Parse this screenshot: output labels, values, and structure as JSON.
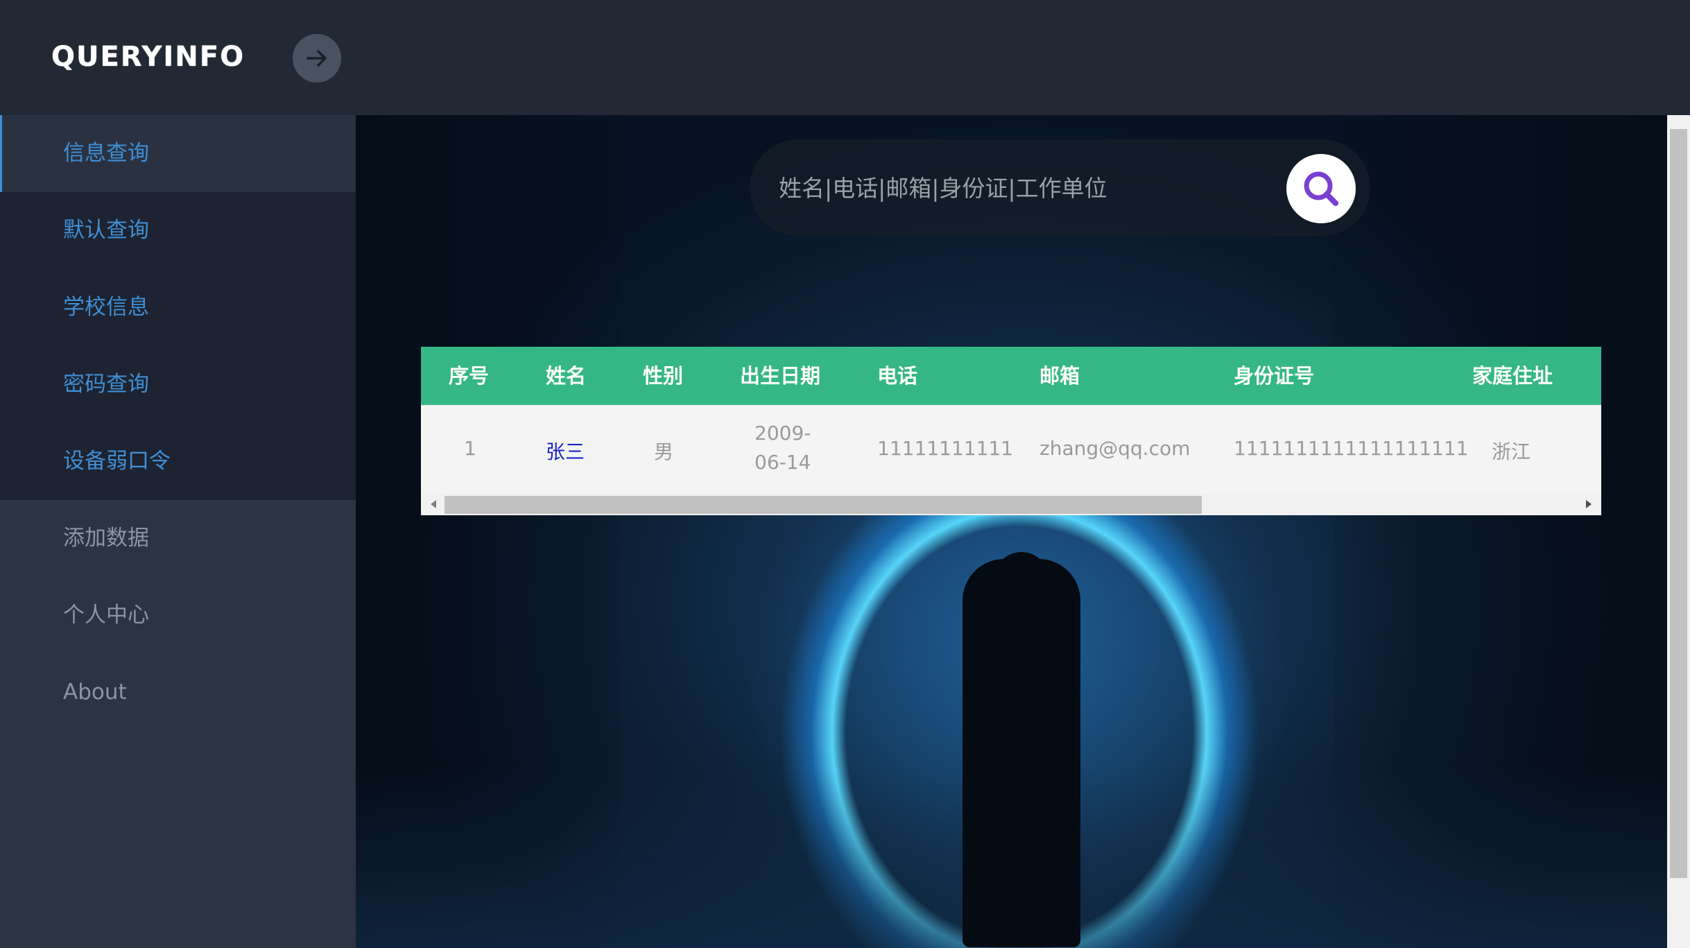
{
  "app": {
    "logo": "QUERYINFO"
  },
  "sidebar": {
    "items": [
      {
        "label": "信息查询"
      },
      {
        "label": "默认查询"
      },
      {
        "label": "学校信息"
      },
      {
        "label": "密码查询"
      },
      {
        "label": "设备弱口令"
      },
      {
        "label": "添加数据"
      },
      {
        "label": "个人中心"
      },
      {
        "label": "About"
      }
    ]
  },
  "search": {
    "placeholder": "姓名|电话|邮箱|身份证|工作单位",
    "icon": "search-icon"
  },
  "table": {
    "headers": [
      "序号",
      "姓名",
      "性别",
      "出生日期",
      "电话",
      "邮箱",
      "身份证号",
      "家庭住址"
    ],
    "rows": [
      {
        "index": "1",
        "name": "张三",
        "gender": "男",
        "birth_line1": "2009-",
        "birth_line2": "06-14",
        "phone": "11111111111",
        "email": "zhang@qq.com",
        "id_number": "1111111111111111111",
        "address": "浙江"
      }
    ]
  },
  "colors": {
    "accent_link": "#3f8fd6",
    "table_header": "#35b785",
    "topbar": "#222935"
  }
}
